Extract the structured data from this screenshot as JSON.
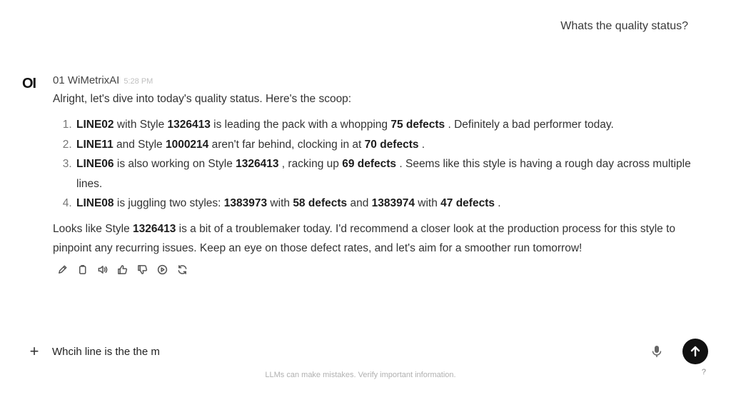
{
  "user_message": "Whats the quality status?",
  "assistant": {
    "avatar": "OI",
    "name": "01 WiMetrixAI",
    "time": "5:28 PM",
    "intro": "Alright, let's dive into today's quality status. Here's the scoop:",
    "items": [
      {
        "line": "LINE02",
        "t1": " with Style ",
        "style": "1326413",
        "t2": " is leading the pack with a whopping ",
        "defects": "75 defects",
        "t3": " . Definitely a bad performer today."
      },
      {
        "line": "LINE11",
        "t1": " and Style ",
        "style": "1000214",
        "t2": " aren't far behind, clocking in at ",
        "defects": "70 defects",
        "t3": " ."
      },
      {
        "line": "LINE06",
        "t1": " is also working on Style ",
        "style": "1326413",
        "t2": " , racking up ",
        "defects": "69 defects",
        "t3": " . Seems like this style is having a rough day across multiple lines."
      },
      {
        "line": "LINE08",
        "t1": " is juggling two styles: ",
        "style": "1383973",
        "t2": " with ",
        "defects": "58 defects",
        "t3": " and ",
        "style2": "1383974",
        "t4": " with ",
        "defects2": "47 defects",
        "t5": " ."
      }
    ],
    "outro_pre": "Looks like Style ",
    "outro_style": "1326413",
    "outro_post": " is a bit of a troublemaker today. I'd recommend a closer look at the production process for this style to pinpoint any recurring issues. Keep an eye on those defect rates, and let's aim for a smoother run tomorrow!",
    "actions": [
      "edit-icon",
      "copy-icon",
      "read-aloud-icon",
      "thumbs-up-icon",
      "thumbs-down-icon",
      "play-icon",
      "regenerate-icon"
    ]
  },
  "input": {
    "value": "Whcih line is the the m",
    "plus": "+"
  },
  "disclaimer": "LLMs can make mistakes. Verify important information.",
  "help": "?"
}
